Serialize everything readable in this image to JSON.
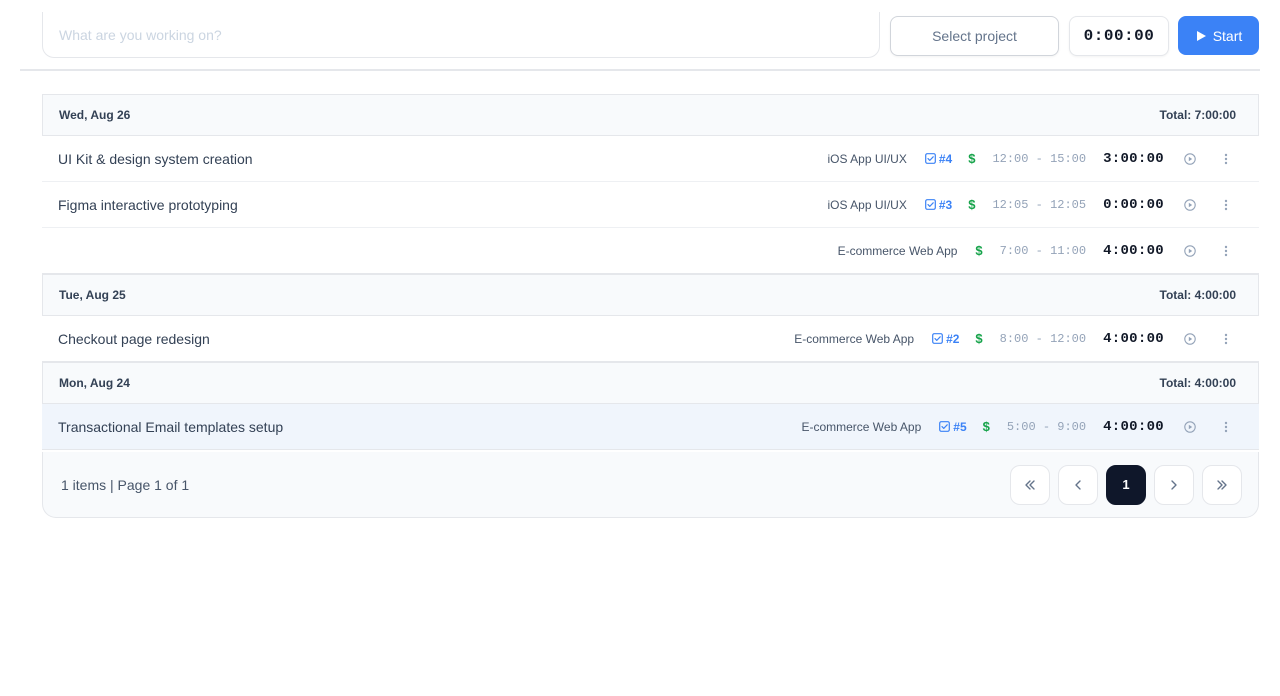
{
  "topbar": {
    "task_placeholder": "What are you working on?",
    "task_value": "",
    "project_select_label": "Select project",
    "timer": "0:00:00",
    "start_label": "Start",
    "accent_color": "#3b82f6"
  },
  "groups": [
    {
      "date": "Wed, Aug 26",
      "total": "Total: 7:00:00",
      "entries": [
        {
          "description": "UI Kit & design system creation",
          "project": "iOS App UI/UX",
          "task": "#4",
          "billable": "$",
          "range": "12:00 - 15:00",
          "duration": "3:00:00"
        },
        {
          "description": "Figma interactive prototyping",
          "project": "iOS App UI/UX",
          "task": "#3",
          "billable": "$",
          "range": "12:05 - 12:05",
          "duration": "0:00:00"
        },
        {
          "description": "",
          "project": "E-commerce Web App",
          "task": "",
          "billable": "$",
          "range": "7:00 - 11:00",
          "duration": "4:00:00"
        }
      ]
    },
    {
      "date": "Tue, Aug 25",
      "total": "Total: 4:00:00",
      "entries": [
        {
          "description": "Checkout page redesign",
          "project": "E-commerce Web App",
          "task": "#2",
          "billable": "$",
          "range": "8:00 - 12:00",
          "duration": "4:00:00"
        }
      ]
    },
    {
      "date": "Mon, Aug 24",
      "total": "Total: 4:00:00",
      "entries": [
        {
          "description": "Transactional Email templates setup",
          "project": "E-commerce Web App",
          "task": "#5",
          "billable": "$",
          "range": "5:00 - 9:00",
          "duration": "4:00:00",
          "highlighted": true
        }
      ]
    }
  ],
  "pagination": {
    "info": "1 items | Page 1 of 1",
    "current_page": "1"
  },
  "icons": {
    "start": "play-icon",
    "task": "checkbox-icon",
    "entry_play": "play-circle-icon",
    "entry_more": "more-vertical-icon",
    "first": "chevrons-left-icon",
    "prev": "chevron-left-icon",
    "next": "chevron-right-icon",
    "last": "chevrons-right-icon"
  }
}
